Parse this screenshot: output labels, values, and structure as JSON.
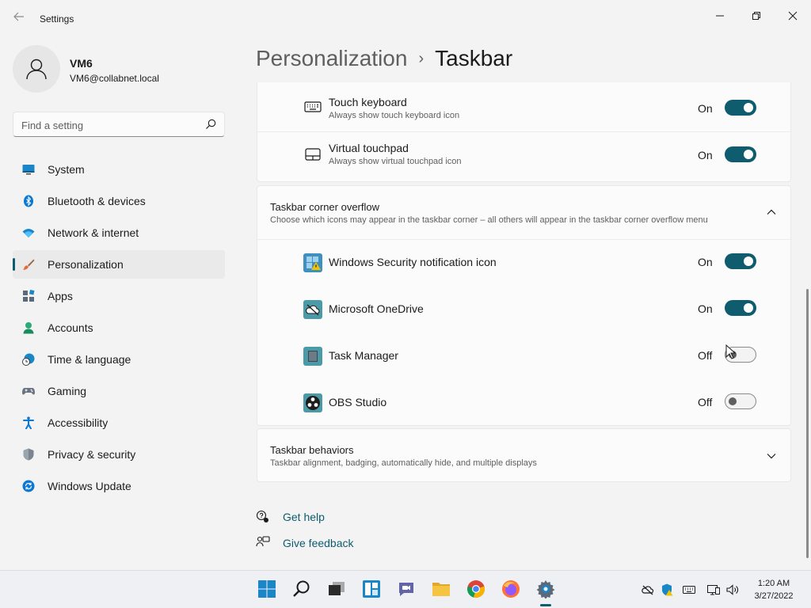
{
  "window": {
    "title": "Settings"
  },
  "profile": {
    "name": "VM6",
    "email": "VM6@collabnet.local"
  },
  "search": {
    "placeholder": "Find a setting"
  },
  "nav": {
    "items": [
      {
        "label": "System",
        "icon": "system-icon"
      },
      {
        "label": "Bluetooth & devices",
        "icon": "bluetooth-icon"
      },
      {
        "label": "Network & internet",
        "icon": "wifi-icon"
      },
      {
        "label": "Personalization",
        "icon": "brush-icon",
        "active": true
      },
      {
        "label": "Apps",
        "icon": "apps-icon"
      },
      {
        "label": "Accounts",
        "icon": "accounts-icon"
      },
      {
        "label": "Time & language",
        "icon": "clock-globe-icon"
      },
      {
        "label": "Gaming",
        "icon": "gamepad-icon"
      },
      {
        "label": "Accessibility",
        "icon": "accessibility-icon"
      },
      {
        "label": "Privacy & security",
        "icon": "shield-icon"
      },
      {
        "label": "Windows Update",
        "icon": "update-icon"
      }
    ]
  },
  "header": {
    "parent": "Personalization",
    "separator": "›",
    "current": "Taskbar"
  },
  "corner_icons": {
    "items": [
      {
        "title": "Touch keyboard",
        "subtitle": "Always show touch keyboard icon",
        "state": "On",
        "icon": "keyboard-icon"
      },
      {
        "title": "Virtual touchpad",
        "subtitle": "Always show virtual touchpad icon",
        "state": "On",
        "icon": "touchpad-icon"
      }
    ]
  },
  "overflow": {
    "title": "Taskbar corner overflow",
    "subtitle": "Choose which icons may appear in the taskbar corner – all others will appear in the taskbar corner overflow menu",
    "items": [
      {
        "title": "Windows Security notification icon",
        "state": "On",
        "icon": "windows-security-icon"
      },
      {
        "title": "Microsoft OneDrive",
        "state": "On",
        "icon": "onedrive-icon"
      },
      {
        "title": "Task Manager",
        "state": "Off",
        "icon": "task-manager-icon"
      },
      {
        "title": "OBS Studio",
        "state": "Off",
        "icon": "obs-icon"
      }
    ]
  },
  "behaviors": {
    "title": "Taskbar behaviors",
    "subtitle": "Taskbar alignment, badging, automatically hide, and multiple displays"
  },
  "help": {
    "get_help": "Get help",
    "give_feedback": "Give feedback"
  },
  "taskbar": {
    "apps": [
      "start-icon",
      "search-icon",
      "task-view-icon",
      "widgets-icon",
      "teams-chat-icon",
      "file-explorer-icon",
      "chrome-icon",
      "firefox-icon",
      "settings-icon"
    ],
    "tray": [
      "onedrive-tray-icon",
      "security-tray-icon",
      "keyboard-tray-icon",
      "network-icon",
      "volume-icon"
    ],
    "time": "1:20 AM",
    "date": "3/27/2022"
  },
  "colors": {
    "accent": "#0f5c6e",
    "background": "#f3f3f3",
    "card": "#fbfbfb"
  }
}
